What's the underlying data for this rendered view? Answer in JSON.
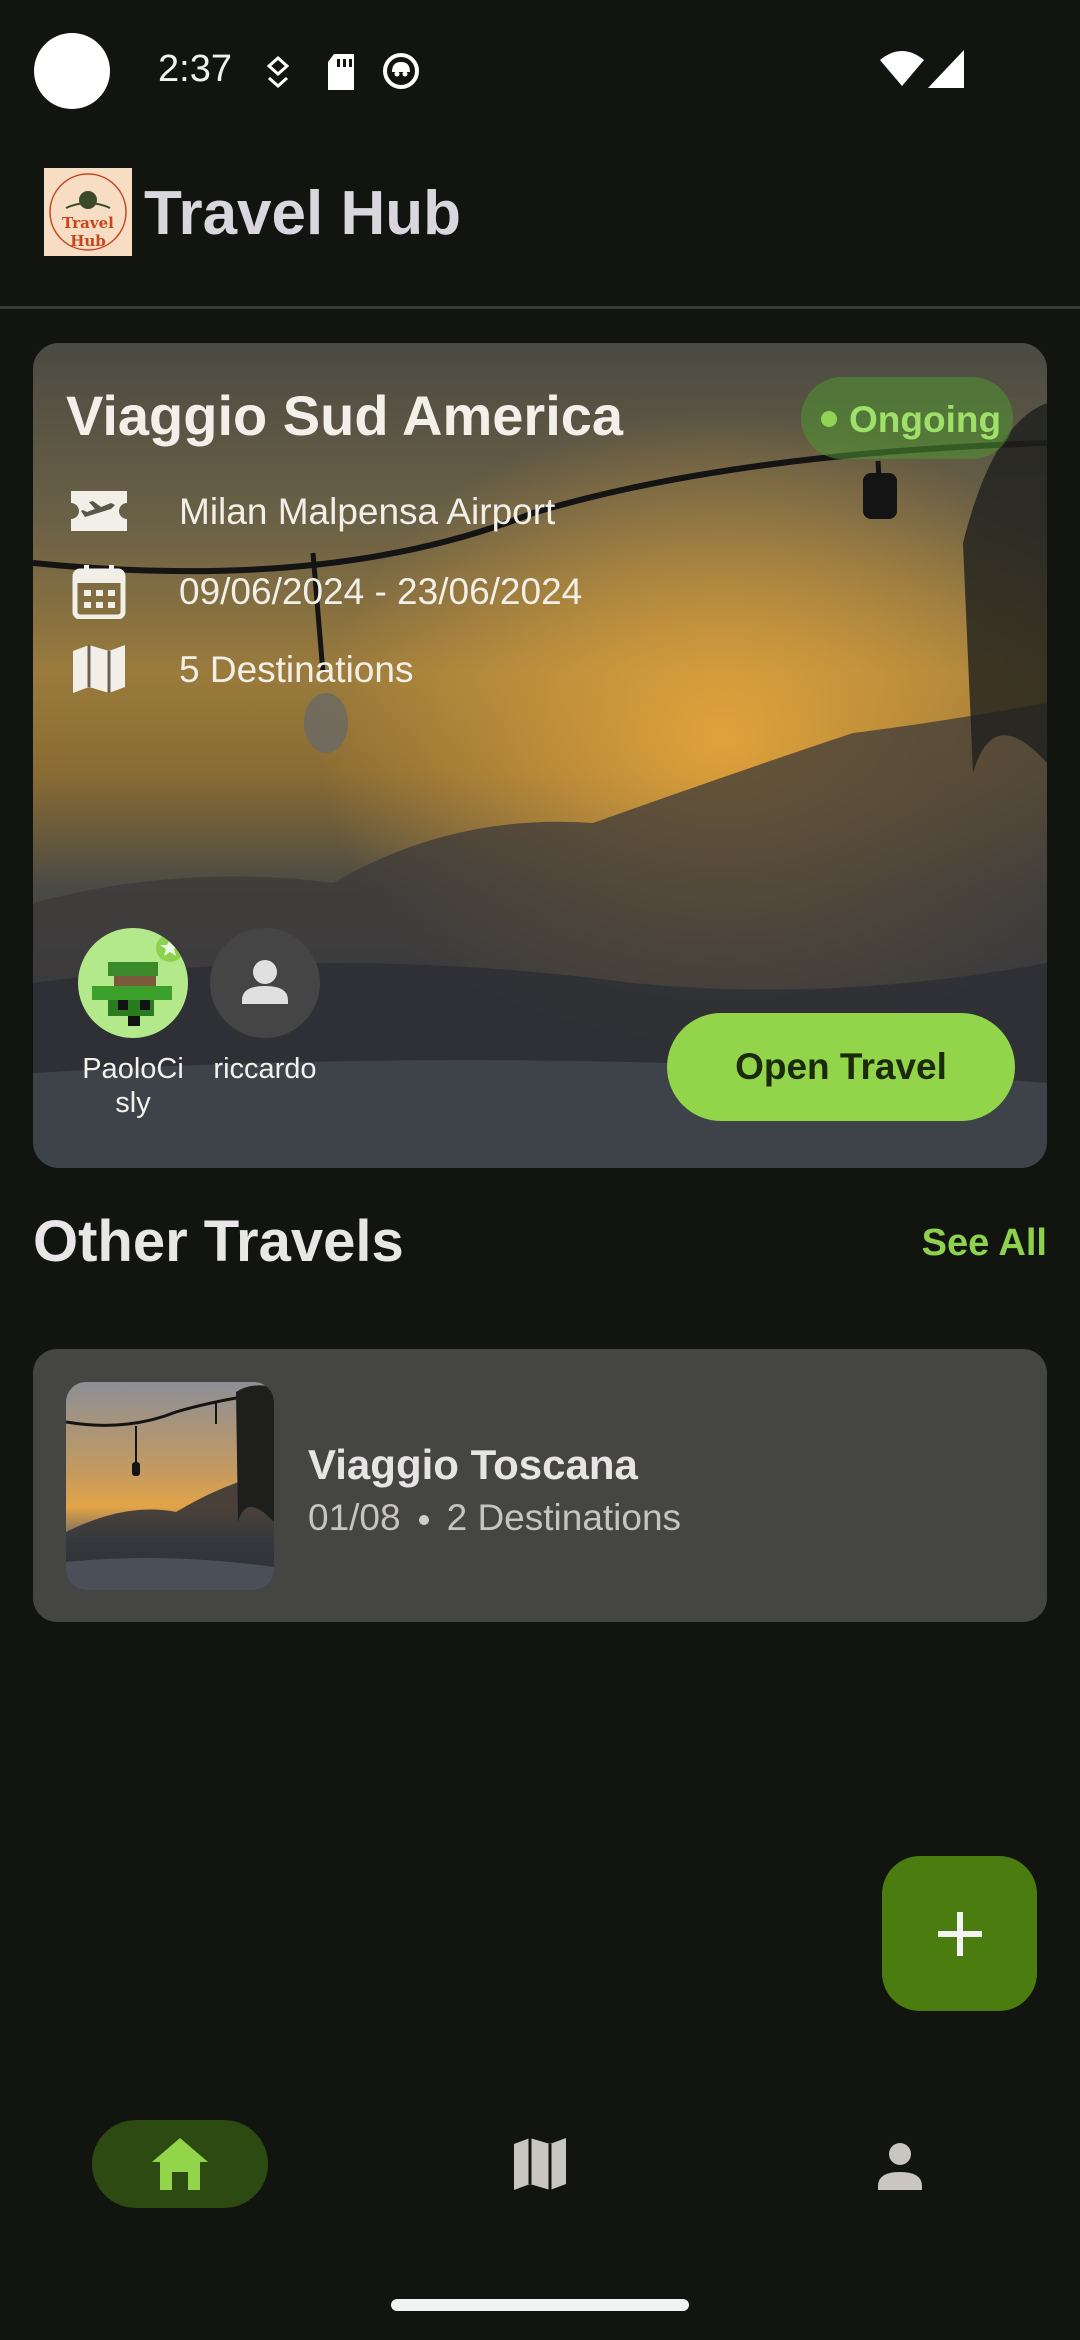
{
  "status_bar": {
    "time": "2:37"
  },
  "header": {
    "title": "Travel Hub",
    "logo_text": "Travel Hub"
  },
  "featured_trip": {
    "title": "Viaggio Sud America",
    "status": "Ongoing",
    "departure": "Milan Malpensa Airport",
    "dates": "09/06/2024 - 23/06/2024",
    "destinations": "5 Destinations",
    "members": [
      {
        "name": "PaoloCisly",
        "display_line1": "PaoloCi",
        "display_line2": "sly"
      },
      {
        "name": "riccardo"
      }
    ],
    "open_button": "Open Travel"
  },
  "other_travels": {
    "section_title": "Other Travels",
    "see_all": "See All",
    "items": [
      {
        "title": "Viaggio Toscana",
        "date": "01/08",
        "destinations": "2 Destinations"
      }
    ]
  },
  "colors": {
    "accent": "#93d54a",
    "fab": "#4b7c0f",
    "background": "#12140f",
    "card": "#454543"
  },
  "bottom_nav": {
    "items": [
      {
        "icon": "home-icon",
        "active": true
      },
      {
        "icon": "map-icon",
        "active": false
      },
      {
        "icon": "person-icon",
        "active": false
      }
    ]
  }
}
